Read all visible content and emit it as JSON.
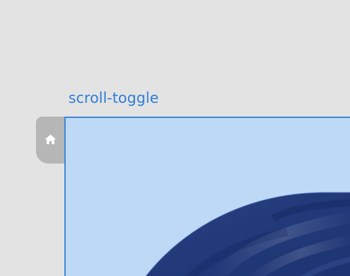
{
  "element": {
    "label": "scroll-toggle"
  },
  "tab": {
    "icon": "home-icon"
  },
  "preview": {
    "content": "dark-blue-fabric-image"
  },
  "colors": {
    "background": "#e3e3e3",
    "label_text": "#2e7dd7",
    "selection_border": "#3f86d4",
    "selection_fill": "#bdd9f6",
    "tab_fill": "#b6b6b6",
    "image_primary": "#233b79"
  }
}
